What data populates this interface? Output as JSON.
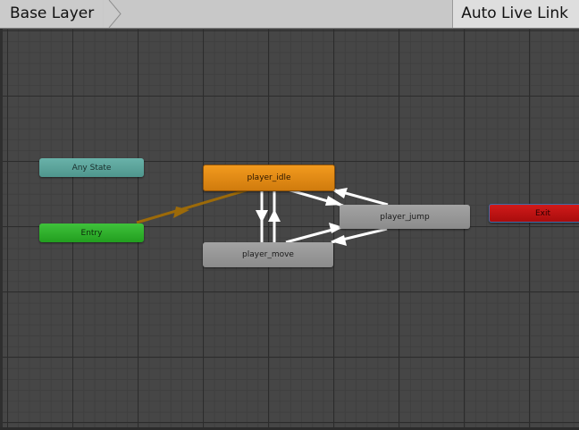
{
  "header": {
    "breadcrumb": [
      "Base Layer"
    ],
    "live_link_label": "Auto Live Link"
  },
  "states": {
    "any_state": "Any State",
    "entry": "Entry",
    "idle": "player_idle",
    "move": "player_move",
    "jump": "player_jump",
    "exit": "Exit"
  },
  "colors": {
    "default_state": "#e8891a",
    "entry": "#2eae2a",
    "any_state": "#5fa79e",
    "exit": "#c21414",
    "state": "#979797",
    "default_transition": "#9c6a09",
    "transition": "#ffffff"
  },
  "transitions": [
    {
      "from": "entry",
      "to": "player_idle",
      "kind": "default"
    },
    {
      "from": "player_idle",
      "to": "player_move"
    },
    {
      "from": "player_move",
      "to": "player_idle"
    },
    {
      "from": "player_idle",
      "to": "player_jump"
    },
    {
      "from": "player_jump",
      "to": "player_idle"
    },
    {
      "from": "player_move",
      "to": "player_jump"
    },
    {
      "from": "player_jump",
      "to": "player_move"
    }
  ]
}
